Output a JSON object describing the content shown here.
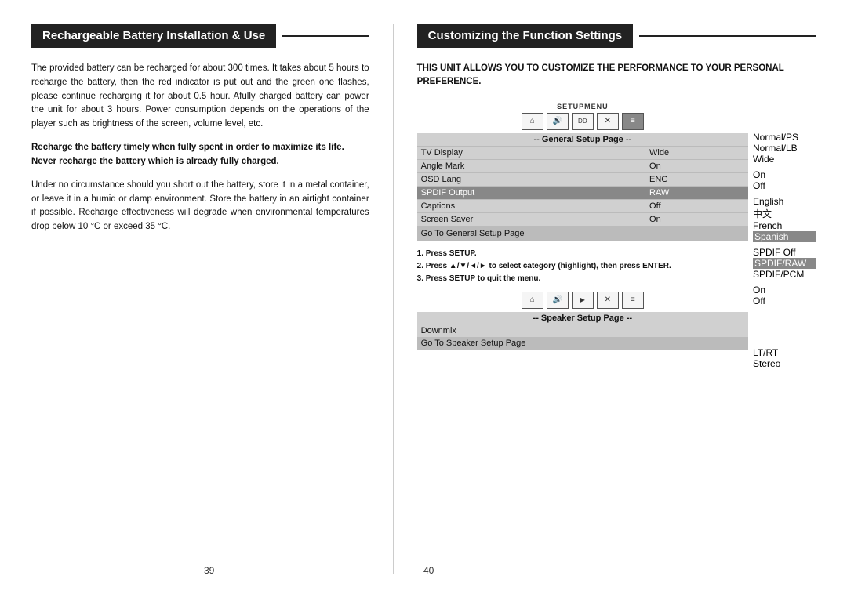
{
  "left": {
    "title": "Rechargeable Battery Installation & Use",
    "paragraphs": [
      "The provided battery can be recharged for about 300 times. It takes about 5 hours to recharge the battery, then the red indicator is put out and the green one flashes, please continue recharging it for about 0.5 hour. Afully charged battery can power the unit for about 3 hours. Power consumption depends on the operations of the player such as brightness of the screen, volume level, etc.",
      "Recharge the battery timely when fully spent in order to maximize its life.",
      "Never recharge the battery which is already fully charged.",
      "Under no circumstance should you short out the battery, store it in a metal container, or leave it in a humid or damp environment. Store the battery in an airtight container if possible. Recharge effectiveness will degrade when environmental temperatures drop below 10 °C or exceed 35 °C."
    ],
    "page_number": "39"
  },
  "right": {
    "title": "Customizing the Function Settings",
    "intro": "THIS UNIT ALLOWS YOU TO CUSTOMIZE THE PERFORMANCE TO YOUR PERSONAL PREFERENCE.",
    "setup_label": "SETUPMENU",
    "general_page": {
      "header": "-- General Setup Page --",
      "rows": [
        {
          "label": "TV Display",
          "value": "Wide"
        },
        {
          "label": "Angle Mark",
          "value": "On"
        },
        {
          "label": "OSD Lang",
          "value": "ENG"
        },
        {
          "label": "SPDIF Output",
          "value": "RAW"
        },
        {
          "label": "Captions",
          "value": "Off"
        },
        {
          "label": "Screen Saver",
          "value": "On"
        }
      ],
      "go_to": "Go To General Setup Page"
    },
    "speaker_page": {
      "header": "-- Speaker Setup Page --",
      "rows": [
        {
          "label": "Downmix",
          "value": ""
        }
      ],
      "go_to": "Go To Speaker Setup Page"
    },
    "callouts_top": {
      "tv_display": [
        "Normal/PS",
        "Normal/LB",
        "Wide"
      ],
      "on_off_1": [
        "On",
        "Off"
      ],
      "osd_lang": [
        "English",
        "中文",
        "French",
        "Spanish"
      ],
      "spdif": [
        "SPDIF Off",
        "SPDIF/RAW",
        "SPDIF/PCM"
      ],
      "on_off_2": [
        "On",
        "Off"
      ]
    },
    "callouts_bottom": {
      "downmix": [
        "LT/RT",
        "Stereo"
      ]
    },
    "instructions": {
      "step1": "1. Press SETUP.",
      "step2": "2. Press ▲/▼/◄/► to select category (highlight), then press ENTER.",
      "step3": "3. Press SETUP to quit the menu."
    },
    "page_number": "40"
  }
}
